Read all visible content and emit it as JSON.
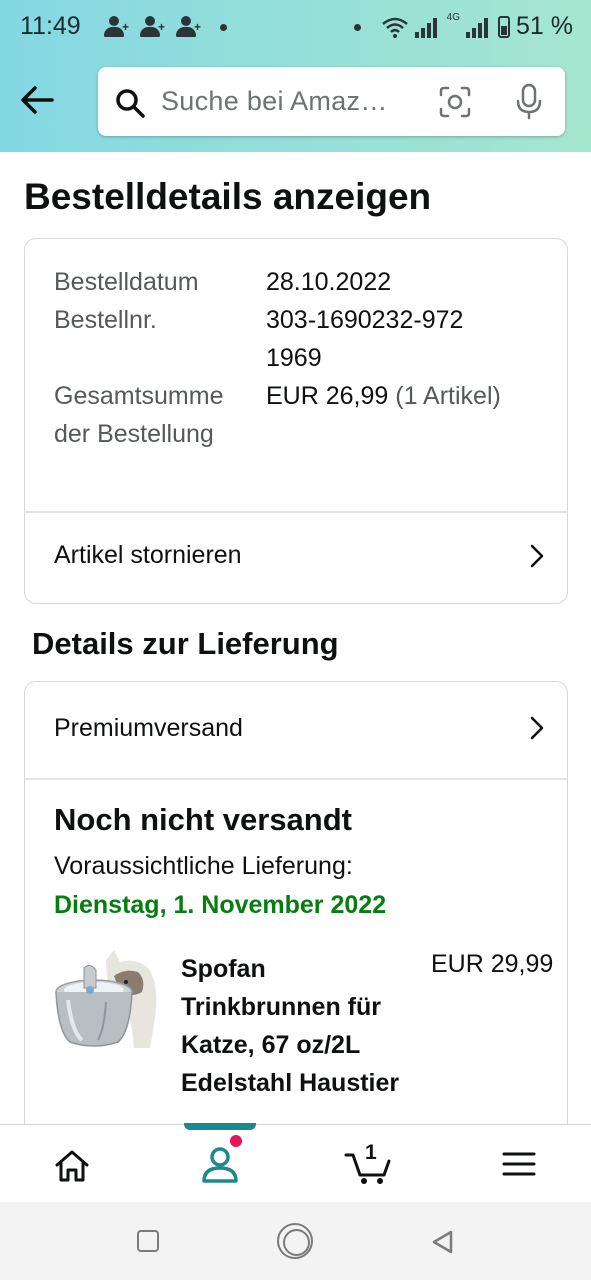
{
  "status_bar": {
    "time": "11:49",
    "network_label": "4G",
    "battery": "51 %"
  },
  "search": {
    "placeholder": "Suche bei Amaz…"
  },
  "page": {
    "title": "Bestelldetails anzeigen"
  },
  "order": {
    "date_label": "Bestelldatum",
    "date_value": "28.10.2022",
    "number_label": "Bestellnr.",
    "number_value": "303-1690232-9721969",
    "total_label": "Gesamtsumme der Bestellung",
    "total_value": "EUR 26,99",
    "total_items": "(1 Artikel)",
    "cancel_link": "Artikel stornieren"
  },
  "delivery": {
    "heading": "Details zur Lieferung",
    "shipping_method": "Premiumversand",
    "status": "Noch nicht versandt",
    "eta_label": "Voraussichtliche Lieferung:",
    "eta_date": "Dienstag, 1. November 2022"
  },
  "product": {
    "name": "Spofan Trinkbrunnen für Katze, 67 oz/2L Edelstahl Haustier",
    "price": "EUR 29,99"
  },
  "bottom_nav": {
    "cart_count": "1"
  },
  "colors": {
    "eta_green": "#067d11",
    "accent_teal": "#1a8a8f",
    "notification_pink": "#e3175a"
  }
}
